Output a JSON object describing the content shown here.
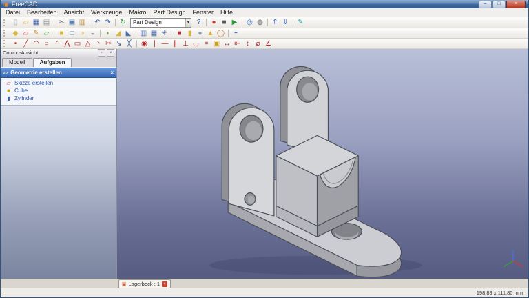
{
  "window": {
    "title": "FreeCAD",
    "logo_glyph": "◉",
    "controls": [
      {
        "name": "minimize-button",
        "glyph": "–"
      },
      {
        "name": "maximize-button",
        "glyph": "□"
      },
      {
        "name": "close-button",
        "glyph": "×"
      }
    ]
  },
  "menubar": {
    "items": [
      "Datei",
      "Bearbeiten",
      "Ansicht",
      "Werkzeuge",
      "Makro",
      "Part Design",
      "Fenster",
      "Hilfe"
    ]
  },
  "toolbars": {
    "workbench_selector": {
      "value": "Part Design",
      "arrow": "▾"
    },
    "standard_left": [
      {
        "name": "new-document-icon",
        "glyph": "▯",
        "color": "#8aa4c8"
      },
      {
        "name": "open-document-icon",
        "glyph": "▱",
        "color": "#d8a43a"
      },
      {
        "name": "save-icon",
        "glyph": "▦",
        "color": "#3a5fa8"
      },
      {
        "name": "print-icon",
        "glyph": "▤",
        "color": "#8a8d94"
      },
      {
        "sep": true
      },
      {
        "name": "cut-icon",
        "glyph": "✂",
        "color": "#6a6d74"
      },
      {
        "name": "copy-icon",
        "glyph": "▣",
        "color": "#5b82b5"
      },
      {
        "name": "paste-icon",
        "glyph": "▥",
        "color": "#b8873a"
      },
      {
        "sep": true
      },
      {
        "name": "undo-icon",
        "glyph": "↶",
        "color": "#2f66c8"
      },
      {
        "name": "redo-icon",
        "glyph": "↷",
        "color": "#2f66c8"
      },
      {
        "sep": true
      },
      {
        "name": "refresh-icon",
        "glyph": "↻",
        "color": "#2f9a3a"
      }
    ],
    "standard_right": [
      {
        "name": "whats-this-icon",
        "glyph": "?",
        "color": "#2f66c8"
      },
      {
        "sep": true
      },
      {
        "name": "macro-record-icon",
        "glyph": "●",
        "color": "#cc2a2a"
      },
      {
        "name": "macro-stop-icon",
        "glyph": "■",
        "color": "#50535a"
      },
      {
        "name": "macro-execute-icon",
        "glyph": "▶",
        "color": "#2f9a3a"
      },
      {
        "sep": true
      },
      {
        "name": "fit-all-icon",
        "glyph": "◎",
        "color": "#2f66c8"
      },
      {
        "name": "draw-style-icon",
        "glyph": "◍",
        "color": "#6a6d74"
      },
      {
        "sep": true
      },
      {
        "name": "export-icon",
        "glyph": "⇑",
        "color": "#2f66c8"
      },
      {
        "name": "import-icon",
        "glyph": "⇓",
        "color": "#2f66c8"
      },
      {
        "sep": true
      },
      {
        "name": "edit-mode-icon",
        "glyph": "✎",
        "color": "#21a3a3"
      }
    ],
    "modeling": [
      {
        "name": "create-body-icon",
        "glyph": "◆",
        "color": "#d8b63a"
      },
      {
        "name": "create-sketch-icon",
        "glyph": "▱",
        "color": "#cc3a3a"
      },
      {
        "name": "edit-sketch-icon",
        "glyph": "✎",
        "color": "#cc8a2a"
      },
      {
        "name": "map-sketch-icon",
        "glyph": "▱",
        "color": "#2f9a3a"
      },
      {
        "sep": true
      },
      {
        "name": "pad-icon",
        "glyph": "■",
        "color": "#d8b63a"
      },
      {
        "name": "pocket-icon",
        "glyph": "□",
        "color": "#4a6fb0"
      },
      {
        "name": "revolution-icon",
        "glyph": "◑",
        "color": "#d8b63a"
      },
      {
        "name": "groove-icon",
        "glyph": "◒",
        "color": "#8a8d94"
      },
      {
        "sep": true
      },
      {
        "name": "fillet-icon",
        "glyph": "◗",
        "color": "#7da33a"
      },
      {
        "name": "chamfer-icon",
        "glyph": "◢",
        "color": "#d8b63a"
      },
      {
        "name": "draft-icon",
        "glyph": "◣",
        "color": "#4a6fb0"
      },
      {
        "sep": true
      },
      {
        "name": "mirrored-icon",
        "glyph": "▥",
        "color": "#4a6fb0"
      },
      {
        "name": "linear-pattern-icon",
        "glyph": "▦",
        "color": "#4a6fb0"
      },
      {
        "name": "polar-pattern-icon",
        "glyph": "✳",
        "color": "#4a6fb0"
      },
      {
        "sep": true
      },
      {
        "name": "box-primitive-icon",
        "glyph": "■",
        "color": "#b03030"
      },
      {
        "name": "cylinder-primitive-icon",
        "glyph": "▮",
        "color": "#d8b63a"
      },
      {
        "name": "sphere-primitive-icon",
        "glyph": "●",
        "color": "#8a96a8"
      },
      {
        "name": "cone-primitive-icon",
        "glyph": "▲",
        "color": "#d8b63a"
      },
      {
        "name": "torus-primitive-icon",
        "glyph": "◯",
        "color": "#c87a2a"
      },
      {
        "sep": true
      },
      {
        "name": "boolean-icon",
        "glyph": "◓",
        "color": "#4a6fb0"
      }
    ],
    "sketcher": [
      {
        "name": "point-icon",
        "glyph": "•",
        "color": "#b22222"
      },
      {
        "name": "line-icon",
        "glyph": "╱",
        "color": "#b22222"
      },
      {
        "name": "arc-icon",
        "glyph": "◠",
        "color": "#b22222"
      },
      {
        "name": "circle-icon",
        "glyph": "○",
        "color": "#b22222"
      },
      {
        "name": "conic-icon",
        "glyph": "◜",
        "color": "#b22222"
      },
      {
        "name": "polyline-icon",
        "glyph": "⋀",
        "color": "#b22222"
      },
      {
        "name": "rectangle-icon",
        "glyph": "▭",
        "color": "#b22222"
      },
      {
        "name": "polygon-icon",
        "glyph": "△",
        "color": "#b22222"
      },
      {
        "name": "fillet-sketch-icon",
        "glyph": "◝",
        "color": "#b22222"
      },
      {
        "name": "trim-icon",
        "glyph": "✂",
        "color": "#b22222"
      },
      {
        "name": "external-geometry-icon",
        "glyph": "↘",
        "color": "#3a5fa8"
      },
      {
        "name": "construction-mode-icon",
        "glyph": "╳",
        "color": "#3a5fa8"
      },
      {
        "sep": true
      },
      {
        "name": "constraint-coincident-icon",
        "glyph": "◉",
        "color": "#b22222"
      },
      {
        "name": "constraint-vertical-icon",
        "glyph": "∣",
        "color": "#b22222"
      },
      {
        "name": "constraint-horizontal-icon",
        "glyph": "―",
        "color": "#b22222"
      },
      {
        "name": "constraint-parallel-icon",
        "glyph": "∥",
        "color": "#b22222"
      },
      {
        "name": "constraint-perpendicular-icon",
        "glyph": "⊥",
        "color": "#b22222"
      },
      {
        "name": "constraint-tangent-icon",
        "glyph": "◡",
        "color": "#b22222"
      },
      {
        "name": "constraint-equal-icon",
        "glyph": "=",
        "color": "#b22222"
      },
      {
        "name": "constraint-lock-icon",
        "glyph": "▣",
        "color": "#caa21e"
      },
      {
        "name": "constraint-distance-icon",
        "glyph": "↔",
        "color": "#b22222"
      },
      {
        "name": "constraint-distance-x-icon",
        "glyph": "⇤",
        "color": "#b22222"
      },
      {
        "name": "constraint-distance-y-icon",
        "glyph": "↕",
        "color": "#b22222"
      },
      {
        "name": "constraint-radius-icon",
        "glyph": "⌀",
        "color": "#b22222"
      },
      {
        "name": "constraint-angle-icon",
        "glyph": "∠",
        "color": "#b22222"
      }
    ]
  },
  "combo_view": {
    "title": "Combo-Ansicht",
    "header_buttons": [
      {
        "name": "float-panel-button",
        "glyph": "▫"
      },
      {
        "name": "close-panel-button",
        "glyph": "×"
      }
    ],
    "tabs": [
      {
        "label": "Modell"
      },
      {
        "label": "Aufgaben",
        "active": true
      }
    ],
    "task_group": {
      "icon_glyph": "▱",
      "title": "Geometrie erstellen",
      "close_glyph": "×"
    },
    "task_items": [
      {
        "label": "Skizze erstellen",
        "glyph": "▱",
        "color": "#cc3a3a"
      },
      {
        "label": "Cube",
        "glyph": "■",
        "color": "#caa21e"
      },
      {
        "label": "Zylinder",
        "glyph": "▮",
        "color": "#3a5fa8"
      }
    ]
  },
  "viewport": {
    "background_top": "#b9c0d8",
    "background_bottom": "#565b82",
    "model_name": "Lagerbock"
  },
  "document_tabs": [
    {
      "label": "Lagerbock : 1",
      "icon_glyph": "▣",
      "icon_color": "#d35426",
      "close_glyph": "×"
    }
  ],
  "statusbar": {
    "dimensions": "198.89 x 111.80 mm"
  }
}
